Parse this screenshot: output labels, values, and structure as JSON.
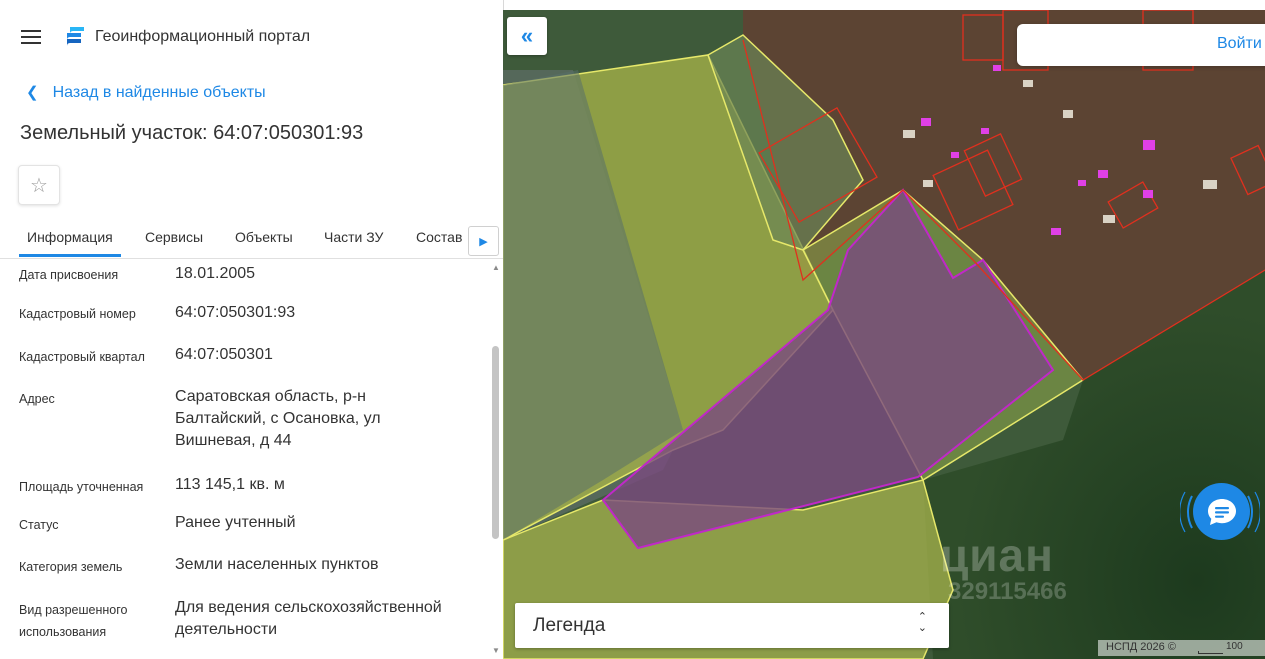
{
  "header": {
    "portal_title": "Геоинформационный портал",
    "back_link": "Назад в найденные объекты",
    "parcel_title": "Земельный участок: 64:07:050301:93"
  },
  "tabs": [
    "Информация",
    "Сервисы",
    "Объекты",
    "Части ЗУ",
    "Состав"
  ],
  "info": {
    "rows": [
      {
        "label": "Дата присвоения",
        "value": "18.01.2005"
      },
      {
        "label": "Кадастровый номер",
        "value": "64:07:050301:93"
      },
      {
        "label": "Кадастровый квартал",
        "value": "64:07:050301"
      },
      {
        "label": "Адрес",
        "value": "Саратовская область, р-н Балтайский, с Осановка, ул Вишневая, д 44"
      },
      {
        "label": "Площадь уточненная",
        "value": "113 145,1 кв. м"
      },
      {
        "label": "Статус",
        "value": "Ранее учтенный"
      },
      {
        "label": "Категория земель",
        "value": "Земли населенных пунктов"
      },
      {
        "label": "Вид разрешенного использования",
        "value": "Для ведения сельскохозяйственной деятельности"
      }
    ]
  },
  "map": {
    "login": "Войти",
    "legend": "Легенда",
    "watermark_logo": "циан",
    "watermark_id": "329115466",
    "copyright": "НСПД 2026 ©",
    "scale": "100"
  },
  "colors": {
    "accent": "#1e88e5",
    "selected_parcel": "#c028c8",
    "parcel_yellow": "#d6e05a",
    "settlement_red": "#e0301e"
  }
}
